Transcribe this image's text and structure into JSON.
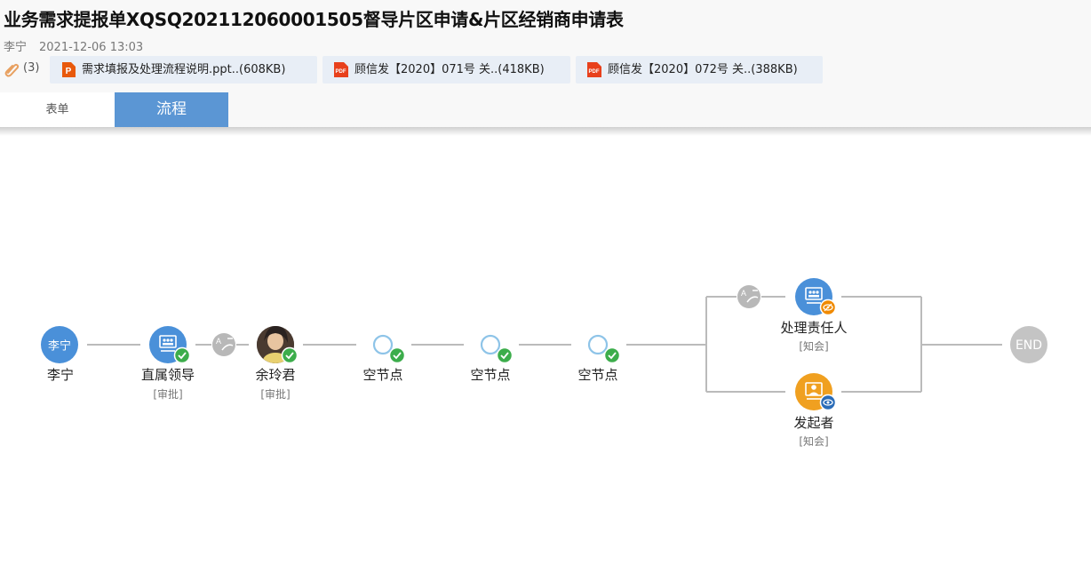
{
  "document": {
    "title": "业务需求提报单XQSQ202112060001505督导片区申请&片区经销商申请表",
    "author": "李宁",
    "date": "2021-12-06 13:03"
  },
  "attachments": {
    "count": "(3)",
    "files": [
      {
        "name": "需求填报及处理流程说明.ppt..(608KB)",
        "type": "ppt"
      },
      {
        "name": "顾信发【2020】071号 关..(418KB)",
        "type": "pdf"
      },
      {
        "name": "顾信发【2020】072号 关..(388KB)",
        "type": "pdf"
      }
    ]
  },
  "tabs": [
    {
      "label": "表单",
      "active": false
    },
    {
      "label": "流程",
      "active": true
    }
  ],
  "flow": {
    "nodes": [
      {
        "id": "initiator",
        "label": "李宁",
        "avatar_text": "李宁",
        "sub": ""
      },
      {
        "id": "direct-leader",
        "label": "直属领导",
        "sub": "[审批]",
        "status": "done"
      },
      {
        "id": "yu-lingjun",
        "label": "余玲君",
        "sub": "[审批]",
        "status": "done"
      },
      {
        "id": "empty-1",
        "label": "空节点",
        "sub": "",
        "status": "done"
      },
      {
        "id": "empty-2",
        "label": "空节点",
        "sub": "",
        "status": "done"
      },
      {
        "id": "empty-3",
        "label": "空节点",
        "sub": "",
        "status": "done"
      },
      {
        "id": "handler",
        "label": "处理责任人",
        "sub": "[知会]",
        "status": "pending"
      },
      {
        "id": "originator",
        "label": "发起者",
        "sub": "[知会]",
        "status": "viewing"
      },
      {
        "id": "end",
        "label": "END"
      }
    ]
  },
  "colors": {
    "tab_active": "#5b96d4",
    "node_blue": "#4a90d9",
    "node_orange": "#f0a020",
    "check_green": "#3cad4b",
    "line_gray": "#bbbbbb",
    "end_gray": "#c4c4c4"
  }
}
